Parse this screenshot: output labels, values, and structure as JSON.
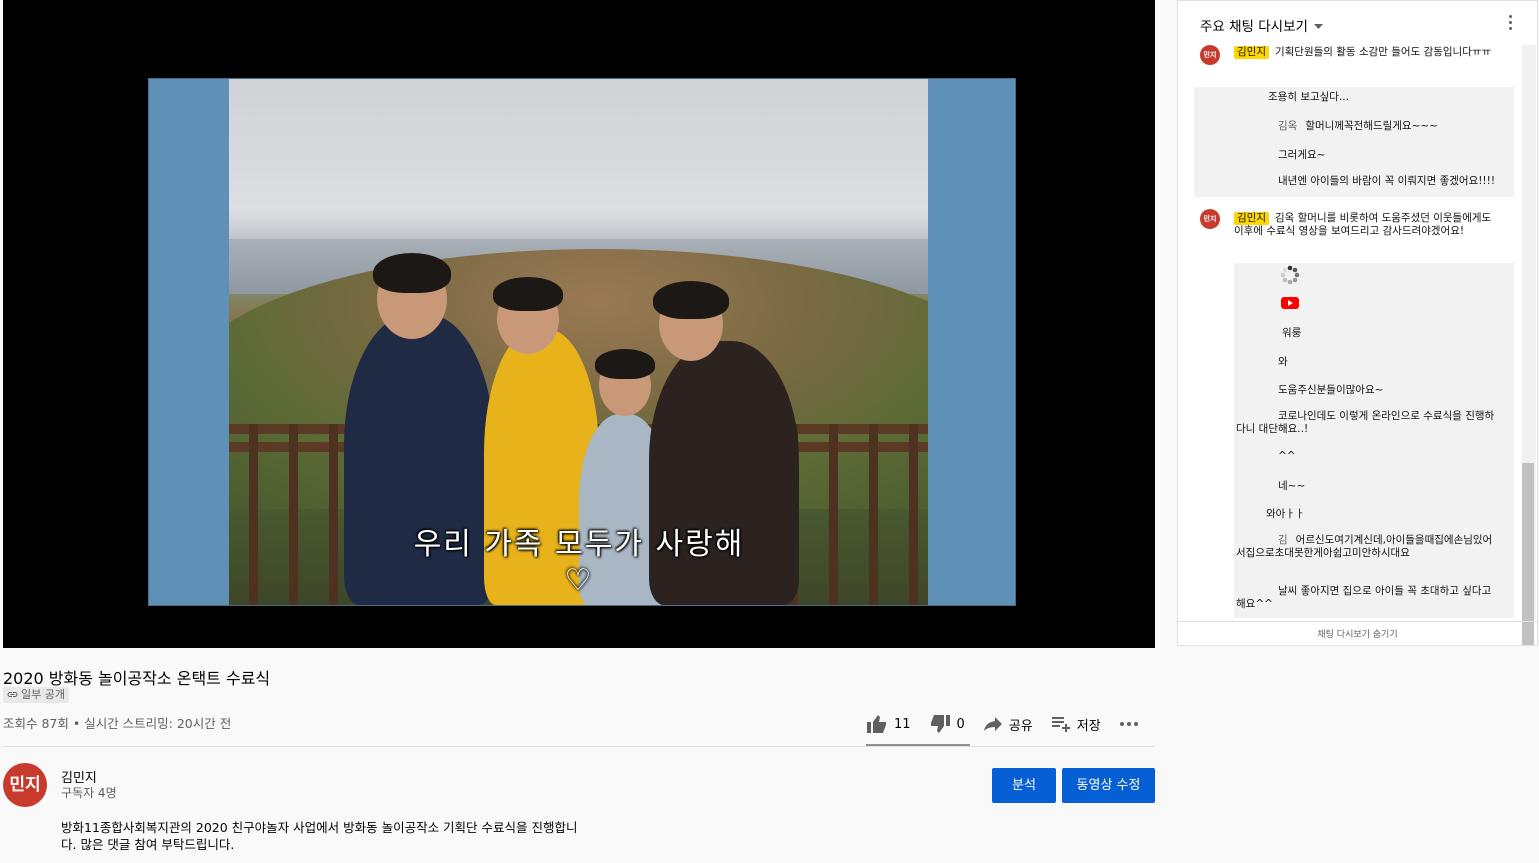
{
  "video": {
    "caption": "우리 가족 모두가 사랑해♡",
    "title": "2020 방화동 놀이공작소 온택트 수료식",
    "visibility": "일부 공개",
    "stats": "조회수 87회 • 실시간 스트리밍: 20시간 전",
    "likes": "11",
    "dislikes": "0",
    "share_label": "공유",
    "save_label": "저장"
  },
  "channel": {
    "avatar_text": "민지",
    "name": "김민지",
    "subscribers": "구독자 4명"
  },
  "buttons": {
    "analytics": "분석",
    "edit_video": "동영상 수정"
  },
  "description": {
    "line1": "방화11종합사회복지관의 2020 친구야놀자 사업에서 방화동 놀이공작소 기획단 수료식을 진행합니",
    "line2": "다. 많은 댓글 참여 부탁드립니다."
  },
  "chat": {
    "mode": "주요 채팅 다시보기",
    "avatar_text": "민지",
    "messages": [
      {
        "author": "김민지",
        "text": "기획단원들의 활동 소감만 들어도 감동입니다ㅠㅠ"
      },
      {
        "author": "",
        "text": "조용히 보고싶다..."
      },
      {
        "author": "김옥",
        "text": "할머니께꼭전해드릴게요~~~"
      },
      {
        "author": "",
        "text": "그러게요~"
      },
      {
        "author": "",
        "text": "내년엔 아이들의 바람이 꼭 이뤄지면 좋겠어요!!!!"
      },
      {
        "author": "김민지",
        "text": "김옥     할머니를 비롯하여 도움주셨던 이웃들에게도 이후에 수료식 영상을 보여드리고 감사드려야겠어요!"
      },
      {
        "author": "",
        "text": "워룽"
      },
      {
        "author": "",
        "text": "와"
      },
      {
        "author": "",
        "text": "도움주신분들이많아요~"
      },
      {
        "author": "",
        "text": "코로나인데도 이렇게 온라인으로 수료식을 진행하다니 대단해요..!"
      },
      {
        "author": "",
        "text": "^^"
      },
      {
        "author": "",
        "text": "네~~"
      },
      {
        "author": "",
        "text": "와아ㅏㅏ"
      },
      {
        "author": "김",
        "text": "어르신도여기계신데,아이들을때집에손님있어서집으로초대못한게아쉽고미안하시대요"
      },
      {
        "author": "",
        "text": "날씨 좋아지면 집으로 아이들 꼭 초대하고 싶다고 해요^^"
      }
    ],
    "footer": "채팅 다시보기 숨기기"
  },
  "colors": {
    "accent_blue": "#065fd4",
    "avatar_red": "#c83a2c",
    "author_highlight": "#ffd600"
  },
  "icons": [
    "thumbs-up-icon",
    "thumbs-down-icon",
    "share-icon",
    "save-playlist-icon",
    "more-icon",
    "link-icon",
    "dropdown-icon",
    "youtube-icon",
    "spinner-icon"
  ]
}
